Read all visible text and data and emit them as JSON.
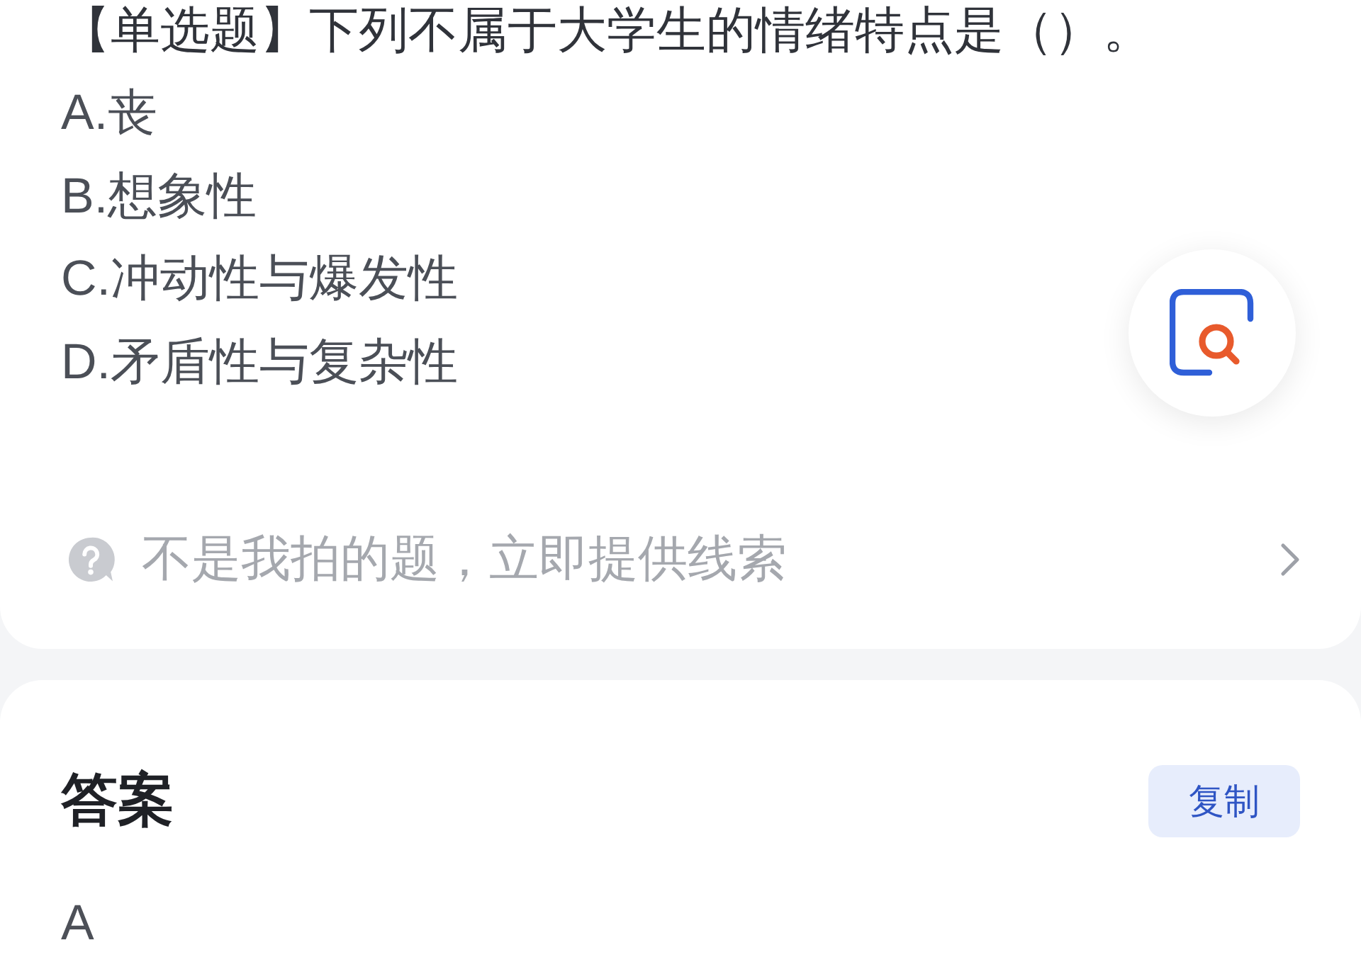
{
  "question": {
    "text": "【单选题】下列不属于大学生的情绪特点是（）。",
    "options": [
      "A.丧",
      "B.想象性",
      "C.冲动性与爆发性",
      "D.矛盾性与复杂性"
    ]
  },
  "feedback_link": {
    "text": "不是我拍的题，立即提供线索"
  },
  "answer": {
    "title": "答案",
    "copy_button": "复制",
    "value": "A"
  }
}
